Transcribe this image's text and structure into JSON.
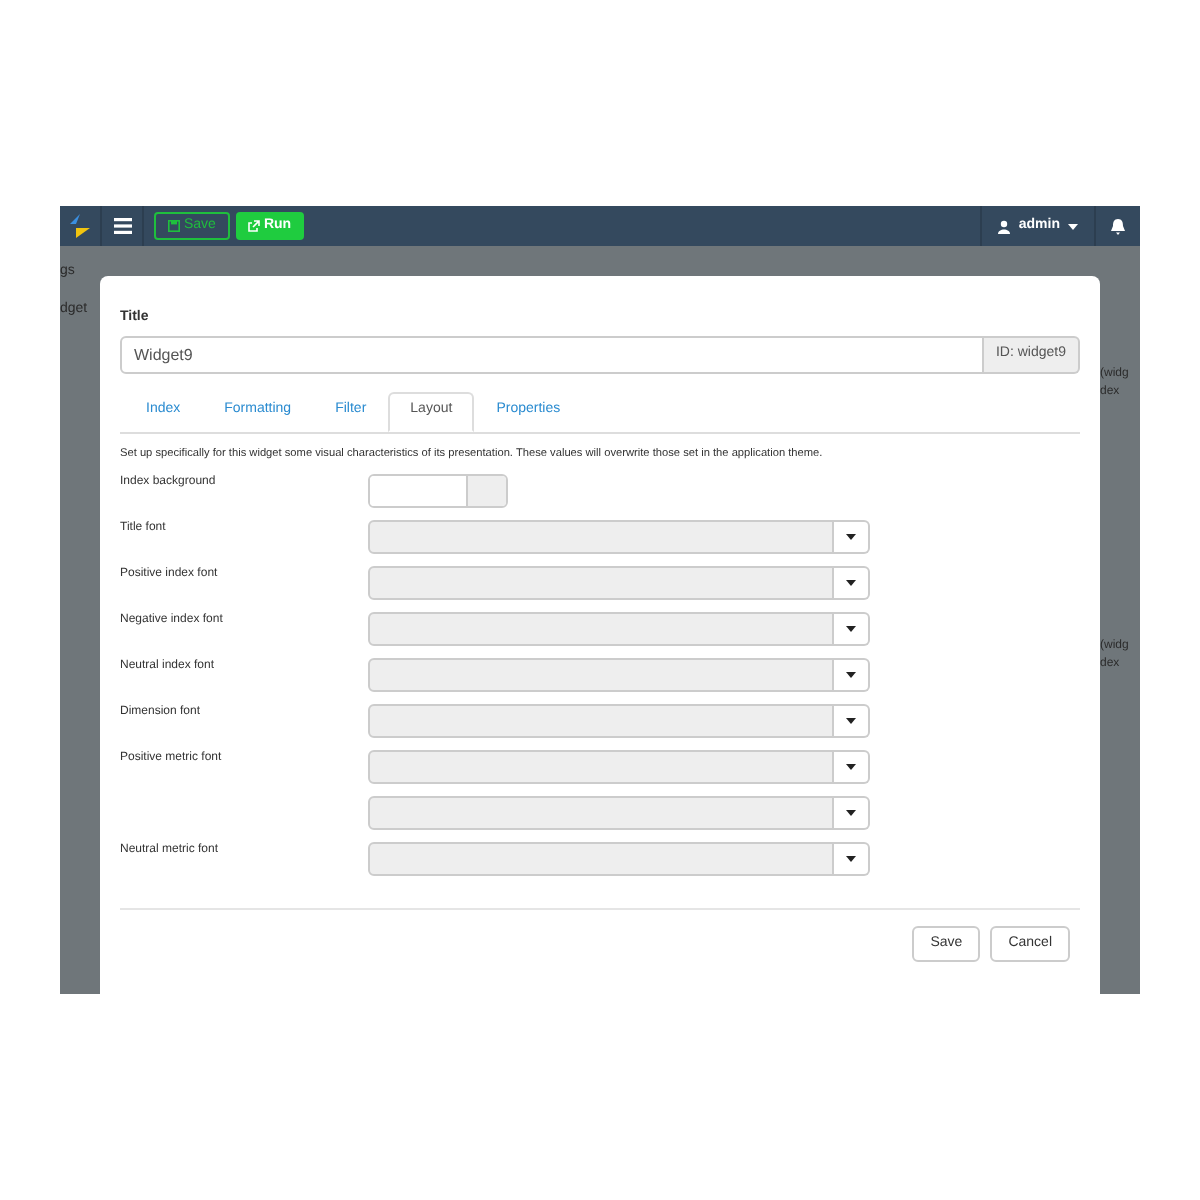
{
  "navbar": {
    "save_label": "Save",
    "run_label": "Run",
    "user": "admin"
  },
  "background": {
    "left": [
      "gs",
      "dget"
    ],
    "right_top": [
      "(widg",
      "dex"
    ],
    "right_bottom": [
      "(widg",
      "dex"
    ]
  },
  "modal": {
    "title_label": "Title",
    "title_value": "Widget9",
    "id_addon": "ID: widget9",
    "tabs": [
      {
        "label": "Index",
        "selected": false
      },
      {
        "label": "Formatting",
        "selected": false
      },
      {
        "label": "Filter",
        "selected": false
      },
      {
        "label": "Layout",
        "selected": true
      },
      {
        "label": "Properties",
        "selected": false
      }
    ],
    "description": "Set up specifically for this widget some visual characteristics of its presentation. These values will overwrite those set in the application theme.",
    "rows": [
      {
        "kind": "color",
        "label": "Index background"
      },
      {
        "kind": "select",
        "label": "Title font"
      },
      {
        "kind": "select",
        "label": "Positive index font"
      },
      {
        "kind": "select",
        "label": "Negative index font"
      },
      {
        "kind": "select",
        "label": "Neutral index font"
      },
      {
        "kind": "select",
        "label": "Dimension font"
      },
      {
        "kind": "select",
        "label": "Positive metric font"
      },
      {
        "kind": "select"
      },
      {
        "kind": "select",
        "label": "Neutral metric font"
      }
    ],
    "buttons": [
      "Save",
      "Cancel"
    ]
  }
}
